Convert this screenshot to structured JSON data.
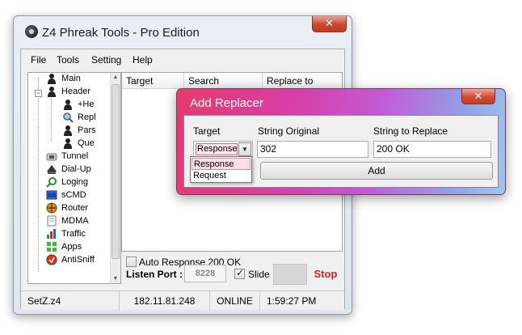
{
  "window": {
    "title": "Z4 Phreak Tools - Pro Edition",
    "close_label": "✕"
  },
  "menu": [
    "File",
    "Tools",
    "Setting",
    "Help"
  ],
  "tree": {
    "items": [
      {
        "label": "Main",
        "icon": "person-icon"
      },
      {
        "label": "Header",
        "icon": "person-icon"
      },
      {
        "label": "+He",
        "icon": "person-icon"
      },
      {
        "label": "Repl",
        "icon": "magnifier-icon"
      },
      {
        "label": "Pars",
        "icon": "person-icon"
      },
      {
        "label": "Que",
        "icon": "person-icon"
      },
      {
        "label": "Tunnel",
        "icon": "tunnel-icon"
      },
      {
        "label": "Dial-Up",
        "icon": "phone-icon"
      },
      {
        "label": "Loging",
        "icon": "search-icon"
      },
      {
        "label": "sCMD",
        "icon": "terminal-icon"
      },
      {
        "label": "Router",
        "icon": "globe-icon"
      },
      {
        "label": "MDMA",
        "icon": "document-icon"
      },
      {
        "label": "Traffic",
        "icon": "chart-icon"
      },
      {
        "label": "Apps",
        "icon": "apps-icon"
      },
      {
        "label": "AntiSniff",
        "icon": "shield-icon"
      }
    ],
    "expander": "−"
  },
  "listview": {
    "columns": [
      "Target",
      "Search",
      "Replace to"
    ]
  },
  "auto_response": {
    "label": "Auto Response 200 OK",
    "checked": false
  },
  "listen": {
    "label": "Listen Port :",
    "port": "8228",
    "slide_label": "Slide",
    "slide_checked": true,
    "stop_label": "Stop"
  },
  "status": {
    "file": "SetZ.z4",
    "ip": "182.11.81.248",
    "state": "ONLINE",
    "time": "1:59:27 PM"
  },
  "dialog": {
    "title": "Add Replacer",
    "close_label": "✕",
    "target_label": "Target",
    "original_label": "String Original",
    "replace_label": "String to Replace",
    "target_value": "Response",
    "original_value": "302",
    "replace_value": "200 OK",
    "add_label": "Add",
    "options": [
      "Response",
      "Request"
    ]
  },
  "colors": {
    "accent_stop": "#d51f1f",
    "dialog_gradient_start": "#e63a6c",
    "dialog_gradient_end": "#a0c6f0"
  }
}
